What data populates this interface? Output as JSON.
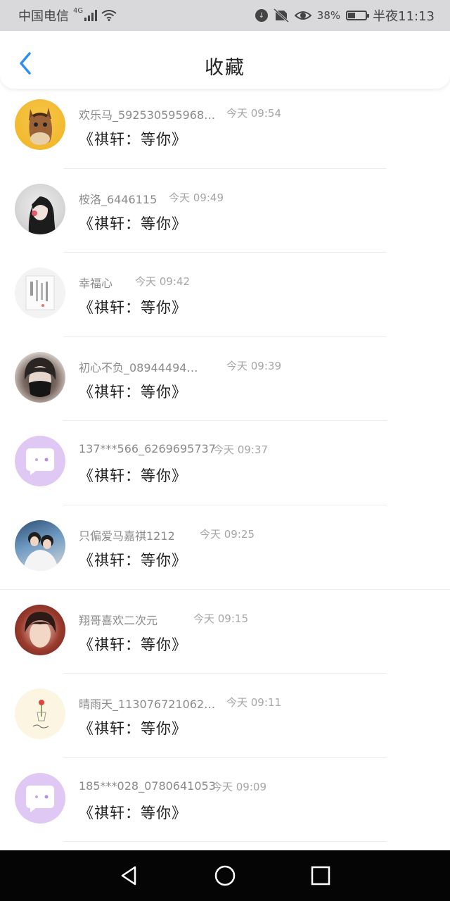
{
  "status_bar": {
    "carrier": "中国电信",
    "network": "4G",
    "battery": "38%",
    "time": "半夜11:13"
  },
  "header": {
    "title": "收藏"
  },
  "items": [
    {
      "name": "欢乐马_592530595968…",
      "time": "今天 09:54",
      "message": "《祺轩：等你》",
      "avatar": "horse-avatar"
    },
    {
      "name": "桉洛_6446115",
      "time": "今天 09:49",
      "message": "《祺轩：等你》",
      "avatar": "girl-avatar"
    },
    {
      "name": "幸福心",
      "time": "今天 09:42",
      "message": "《祺轩：等你》",
      "avatar": "document-avatar"
    },
    {
      "name": "初心不负_08944494…",
      "time": "今天 09:39",
      "message": "《祺轩：等你》",
      "avatar": "masked-boy-avatar"
    },
    {
      "name": "137***566_6269695737",
      "time": "今天 09:37",
      "message": "《祺轩：等你》",
      "avatar": "chat-bubble-avatar"
    },
    {
      "name": "只偏爱马嘉祺1212",
      "time": "今天 09:25",
      "message": "《祺轩：等你》",
      "avatar": "couple-avatar"
    },
    {
      "name": "翔哥喜欢二次元",
      "time": "今天 09:15",
      "message": "《祺轩：等你》",
      "avatar": "boy-avatar"
    },
    {
      "name": "晴雨天_113076721062…",
      "time": "今天 09:11",
      "message": "《祺轩：等你》",
      "avatar": "flower-avatar"
    },
    {
      "name": "185***028_0780641053",
      "time": "今天 09:09",
      "message": "《祺轩：等你》",
      "avatar": "chat-bubble-avatar"
    }
  ],
  "colors": {
    "accent": "#2e8ef2",
    "chat_avatar": "#dfc8f3"
  }
}
